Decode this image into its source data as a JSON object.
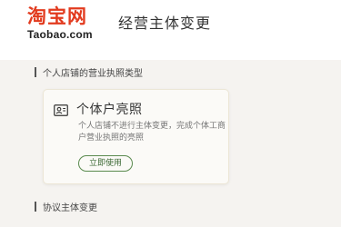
{
  "header": {
    "logo_text": "淘宝网",
    "logo_domain": "Taobao.com",
    "title": "经营主体变更"
  },
  "sections": [
    {
      "heading": "个人店铺的营业执照类型"
    },
    {
      "heading": "协议主体变更"
    }
  ],
  "card": {
    "icon": "license-icon",
    "title": "个体户亮照",
    "description": "个人店铺不进行主体变更，完成个体工商户营业执照的亮照",
    "button_label": "立即使用"
  },
  "colors": {
    "brand": "#e23a1e",
    "button_border": "#5a8a4e",
    "background": "#f5f3f0"
  }
}
